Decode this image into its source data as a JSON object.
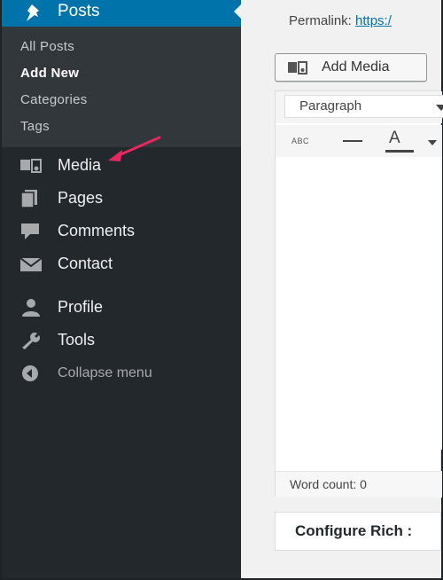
{
  "sidebar": {
    "posts_label": "Posts",
    "submenu": [
      "All Posts",
      "Add New",
      "Categories",
      "Tags"
    ],
    "items": [
      {
        "label": "Media",
        "icon": "media-icon"
      },
      {
        "label": "Pages",
        "icon": "pages-icon"
      },
      {
        "label": "Comments",
        "icon": "comments-icon"
      },
      {
        "label": "Contact",
        "icon": "envelope-icon"
      },
      {
        "label": "Profile",
        "icon": "user-icon"
      },
      {
        "label": "Tools",
        "icon": "wrench-icon"
      },
      {
        "label": "Collapse menu",
        "icon": "collapse-icon"
      }
    ]
  },
  "editor": {
    "permalink_label": "Permalink:",
    "permalink_link": "https:/",
    "add_media_label": "Add Media",
    "format_select": "Paragraph",
    "strikethrough_label": "ABC",
    "textcolor_label": "A",
    "word_count": "Word count: 0",
    "postbox_title": "Configure Rich :"
  },
  "colors": {
    "sidebar_bg": "#23282d",
    "submenu_bg": "#32373c",
    "active_blue": "#0073aa",
    "arrow_pink": "#e8265f"
  }
}
